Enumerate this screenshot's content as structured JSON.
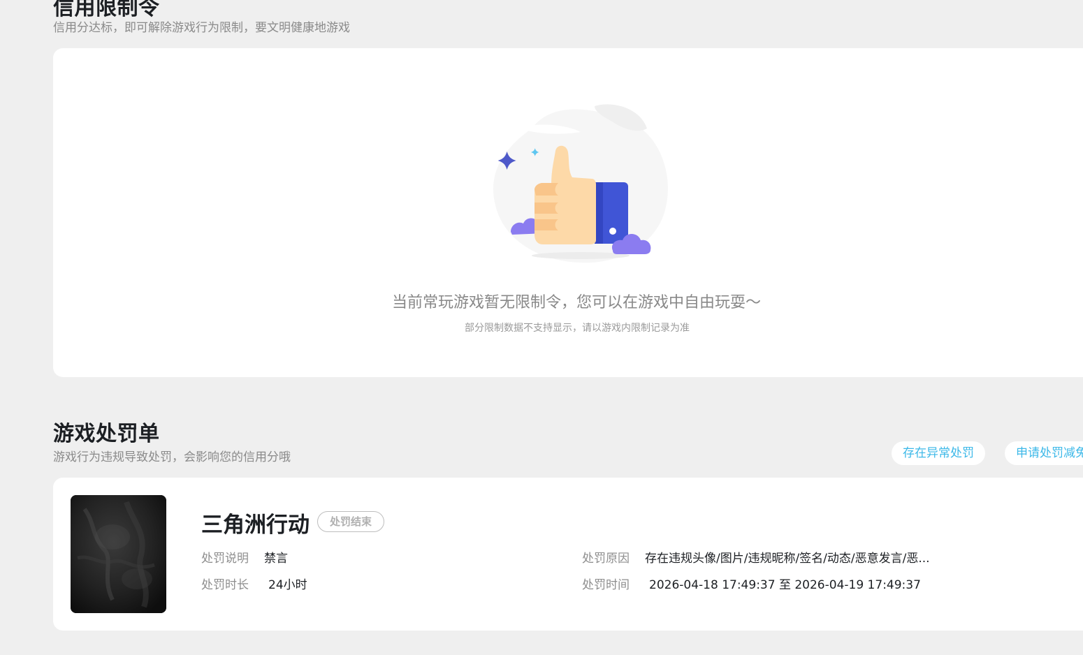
{
  "restriction": {
    "title": "信用限制令",
    "subtitle": "信用分达标，即可解除游戏行为限制，要文明健康地游戏",
    "empty_title": "当前常玩游戏暂无限制令，您可以在游戏中自由玩耍～",
    "empty_note": "部分限制数据不支持显示，请以游戏内限制记录为准",
    "illustration_icon": "thumbs-up-icon"
  },
  "punishment": {
    "title": "游戏处罚单",
    "subtitle": "游戏行为违规导致处罚，会影响您的信用分哦",
    "actions": {
      "abnormal_label": "存在异常处罚",
      "reduce_label": "申请处罚减免"
    },
    "record": {
      "game_name": "三角洲行动",
      "status": "处罚结束",
      "desc_label": "处罚说明",
      "desc_value": "禁言",
      "duration_label": "处罚时长",
      "duration_value": "24小时",
      "reason_label": "处罚原因",
      "reason_value": "存在违规头像/图片/违规昵称/签名/动态/恶意发言/恶...",
      "time_label": "处罚时间",
      "time_value": "2026-04-18 17:49:37 至 2026-04-19 17:49:37"
    }
  },
  "colors": {
    "accent": "#3cb8e8",
    "background": "#efefef",
    "card": "#ffffff"
  }
}
